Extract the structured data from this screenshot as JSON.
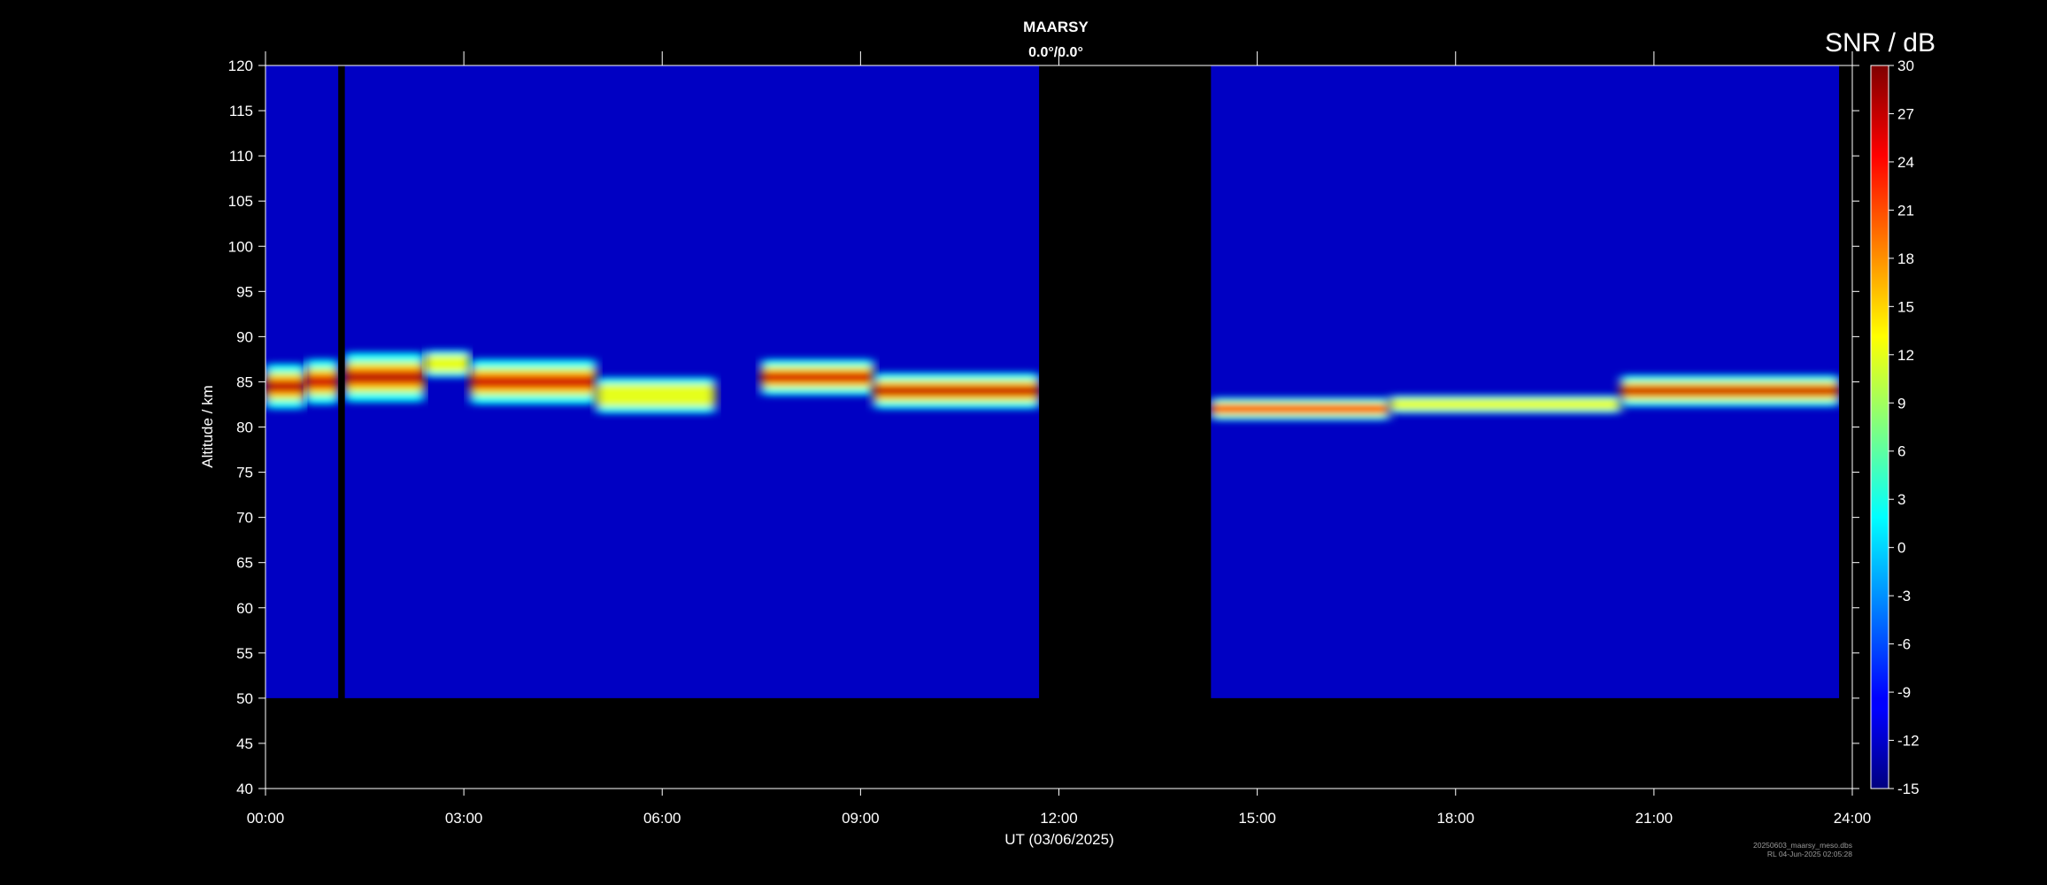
{
  "chart_data": {
    "type": "heatmap",
    "title": "MAARSY",
    "subtitle": "0.0°/0.0°",
    "xlabel": "UT (03/06/2025)",
    "ylabel": "Altitude / km",
    "xlim": [
      0,
      24
    ],
    "ylim": [
      40,
      120
    ],
    "x_tick_labels": [
      "00:00",
      "03:00",
      "06:00",
      "09:00",
      "12:00",
      "15:00",
      "18:00",
      "21:00",
      "24:00"
    ],
    "y_ticks": [
      40,
      45,
      50,
      55,
      60,
      65,
      70,
      75,
      80,
      85,
      90,
      95,
      100,
      105,
      110,
      115,
      120
    ],
    "colorbar": {
      "label": "SNR / dB",
      "range": [
        -15,
        30
      ],
      "ticks": [
        -15,
        -12,
        -9,
        -6,
        -3,
        0,
        3,
        6,
        9,
        12,
        15,
        18,
        21,
        24,
        27,
        30
      ],
      "colormap": "jet"
    },
    "background_snr_db": -12,
    "data_altitude_range": [
      50,
      120
    ],
    "data_gaps_ut_hours": [
      [
        1.1,
        1.2
      ],
      [
        11.7,
        14.3
      ],
      [
        23.8,
        24
      ]
    ],
    "echo_layers": [
      {
        "name": "",
        "t_start": 0.0,
        "t_end": 0.6,
        "center_km": 84.5,
        "thickness_km": 5.0,
        "peak_snr_db": 28
      },
      {
        "name": "",
        "t_start": 0.6,
        "t_end": 1.1,
        "center_km": 85.0,
        "thickness_km": 5.0,
        "peak_snr_db": 27
      },
      {
        "name": "",
        "t_start": 1.2,
        "t_end": 2.4,
        "center_km": 85.5,
        "thickness_km": 5.5,
        "peak_snr_db": 28
      },
      {
        "name": "",
        "t_start": 2.4,
        "t_end": 3.1,
        "center_km": 87.0,
        "thickness_km": 3.0,
        "peak_snr_db": 12
      },
      {
        "name": "",
        "t_start": 3.1,
        "t_end": 5.0,
        "center_km": 85.0,
        "thickness_km": 5.0,
        "peak_snr_db": 27
      },
      {
        "name": "",
        "t_start": 5.0,
        "t_end": 6.8,
        "center_km": 83.5,
        "thickness_km": 4.0,
        "peak_snr_db": 12
      },
      {
        "name": "",
        "t_start": 7.5,
        "t_end": 9.2,
        "center_km": 85.5,
        "thickness_km": 4.0,
        "peak_snr_db": 27
      },
      {
        "name": "",
        "t_start": 9.2,
        "t_end": 11.7,
        "center_km": 84.0,
        "thickness_km": 4.0,
        "peak_snr_db": 28
      },
      {
        "name": "",
        "t_start": 14.3,
        "t_end": 17.0,
        "center_km": 82.0,
        "thickness_km": 2.5,
        "peak_snr_db": 24
      },
      {
        "name": "",
        "t_start": 17.0,
        "t_end": 20.5,
        "center_km": 82.5,
        "thickness_km": 2.0,
        "peak_snr_db": 12
      },
      {
        "name": "",
        "t_start": 20.5,
        "t_end": 23.8,
        "center_km": 84.0,
        "thickness_km": 3.5,
        "peak_snr_db": 28
      }
    ],
    "grid": false,
    "legend": "colorbar-right"
  },
  "footer": {
    "file_name": "20250603_maarsy_meso.dbs",
    "creation_info": "RL 04-Jun-2025 02:05:28"
  }
}
